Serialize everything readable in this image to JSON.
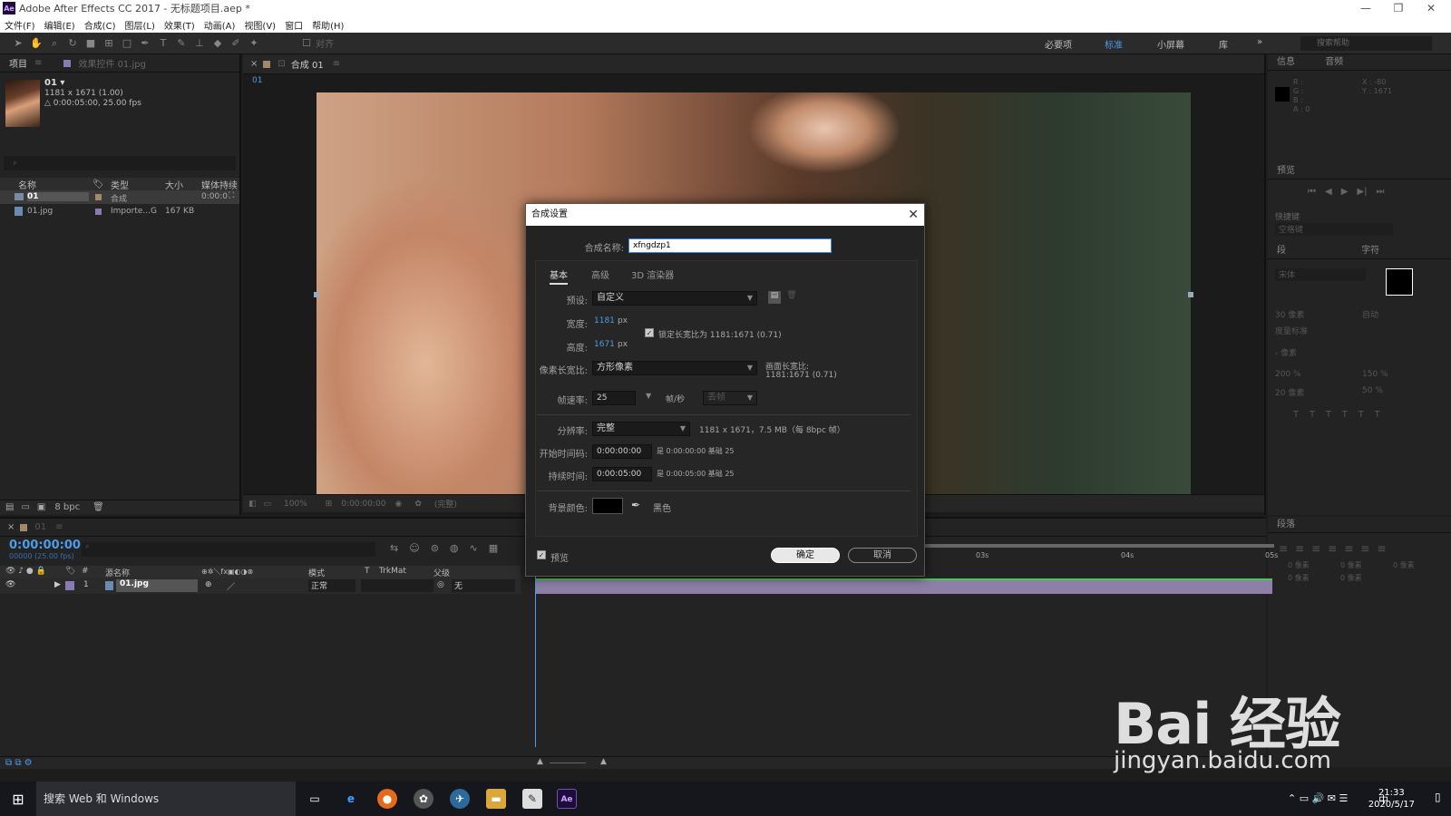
{
  "window": {
    "title": "Adobe After Effects CC 2017 - 无标题项目.aep *",
    "logo": "Ae",
    "controls": [
      "—",
      "❐",
      "✕"
    ]
  },
  "menu": [
    "文件(F)",
    "编辑(E)",
    "合成(C)",
    "图层(L)",
    "效果(T)",
    "动画(A)",
    "视图(V)",
    "窗口",
    "帮助(H)"
  ],
  "toolbar": {
    "snap_label": "对齐",
    "workspaces": [
      "必要项",
      "标准",
      "小屏幕",
      "库"
    ],
    "active_workspace": "标准",
    "help_placeholder": "搜索帮助"
  },
  "project": {
    "tabs": [
      "项目",
      "效果控件 01.jpg"
    ],
    "item_name": "01 ▾",
    "item_size": "1181 x 1671 (1.00)",
    "item_duration": "△ 0:00:05:00, 25.00 fps",
    "search_placeholder": "⌕",
    "columns": [
      "名称",
      "类型",
      "大小",
      "媒体持续"
    ],
    "rows": [
      {
        "name": "01",
        "type": "合成",
        "size": "",
        "duration": "0:00:0"
      },
      {
        "name": "01.jpg",
        "type": "Importe...G",
        "size": "167 KB",
        "duration": ""
      }
    ],
    "bpc": "8 bpc"
  },
  "viewer": {
    "tab": "合成 01",
    "subtab": "01",
    "zoom": "100%",
    "time": "0:00:00:00",
    "quality": "(完整)"
  },
  "right_panel": {
    "info_tabs": [
      "信息",
      "音频"
    ],
    "info_rgb": [
      "R :",
      "G :",
      "B :",
      "A : 0"
    ],
    "info_xy": [
      "X : -80",
      "Y : 1671"
    ],
    "preview_title": "预览",
    "shortcut_label": "快捷键",
    "shortcut_value": "空格键",
    "char_tabs": [
      "段",
      "字符"
    ],
    "font": "宋体",
    "size_label": "30 像素",
    "leading": "自动",
    "tracking_label": "度量标准",
    "stroke": "- 像素",
    "scale_v": "200 %",
    "scale_h": "150 %",
    "baseline": "20 像素",
    "tsume": "50 %",
    "para_title": "段落",
    "para_indent": [
      "0 像素",
      "0 像素",
      "0 像素",
      "0 像素",
      "0 像素"
    ]
  },
  "timeline": {
    "tab": "01",
    "timecode": "0:00:00:00",
    "fps": "00000 (25.00 fps)",
    "columns": [
      "源名称",
      "模式",
      "T",
      "TrkMat",
      "父级"
    ],
    "layer": {
      "index": "1",
      "name": "01.jpg",
      "mode": "正常",
      "parent": "无"
    },
    "ruler": [
      "03s",
      "04s",
      "05s"
    ]
  },
  "dialog": {
    "title": "合成设置",
    "comp_name_label": "合成名称:",
    "comp_name": "xfngdzp1",
    "tabs": [
      "基本",
      "高级",
      "3D 渲染器"
    ],
    "preset_label": "预设:",
    "preset": "自定义",
    "width_label": "宽度:",
    "width": "1181",
    "height_label": "高度:",
    "height": "1671",
    "px": "px",
    "lock_label": "锁定长宽比为 1181:1671 (0.71)",
    "par_label": "像素长宽比:",
    "par": "方形像素",
    "frame_aspect_label": "画面长宽比:",
    "frame_aspect": "1181:1671 (0.71)",
    "fps_label": "帧速率:",
    "fps": "25",
    "fps_unit": "帧/秒",
    "drop_frame": "丢帧",
    "res_label": "分辨率:",
    "res": "完整",
    "res_info": "1181 x 1671，7.5 MB（每 8bpc 帧）",
    "start_label": "开始时间码:",
    "start": "0:00:00:00",
    "start_info": "是 0:00:00:00  基础 25",
    "dur_label": "持续时间:",
    "dur": "0:00:05:00",
    "dur_info": "是 0:00:05:00  基础 25",
    "bg_label": "背景颜色:",
    "bg_name": "黑色",
    "bg_color": "#000000",
    "preview_label": "预览",
    "ok": "确定",
    "cancel": "取消"
  },
  "taskbar": {
    "search": "搜索 Web 和 Windows",
    "time": "21:33",
    "date": "2020/5/17",
    "ime": "中"
  },
  "watermark": {
    "brand": "Bai 经验",
    "url": "jingyan.baidu.com"
  },
  "colors": {
    "accent": "#4d9ce8",
    "layer_bar": "#8d7fa6",
    "work_area": "#3ecf4a"
  }
}
